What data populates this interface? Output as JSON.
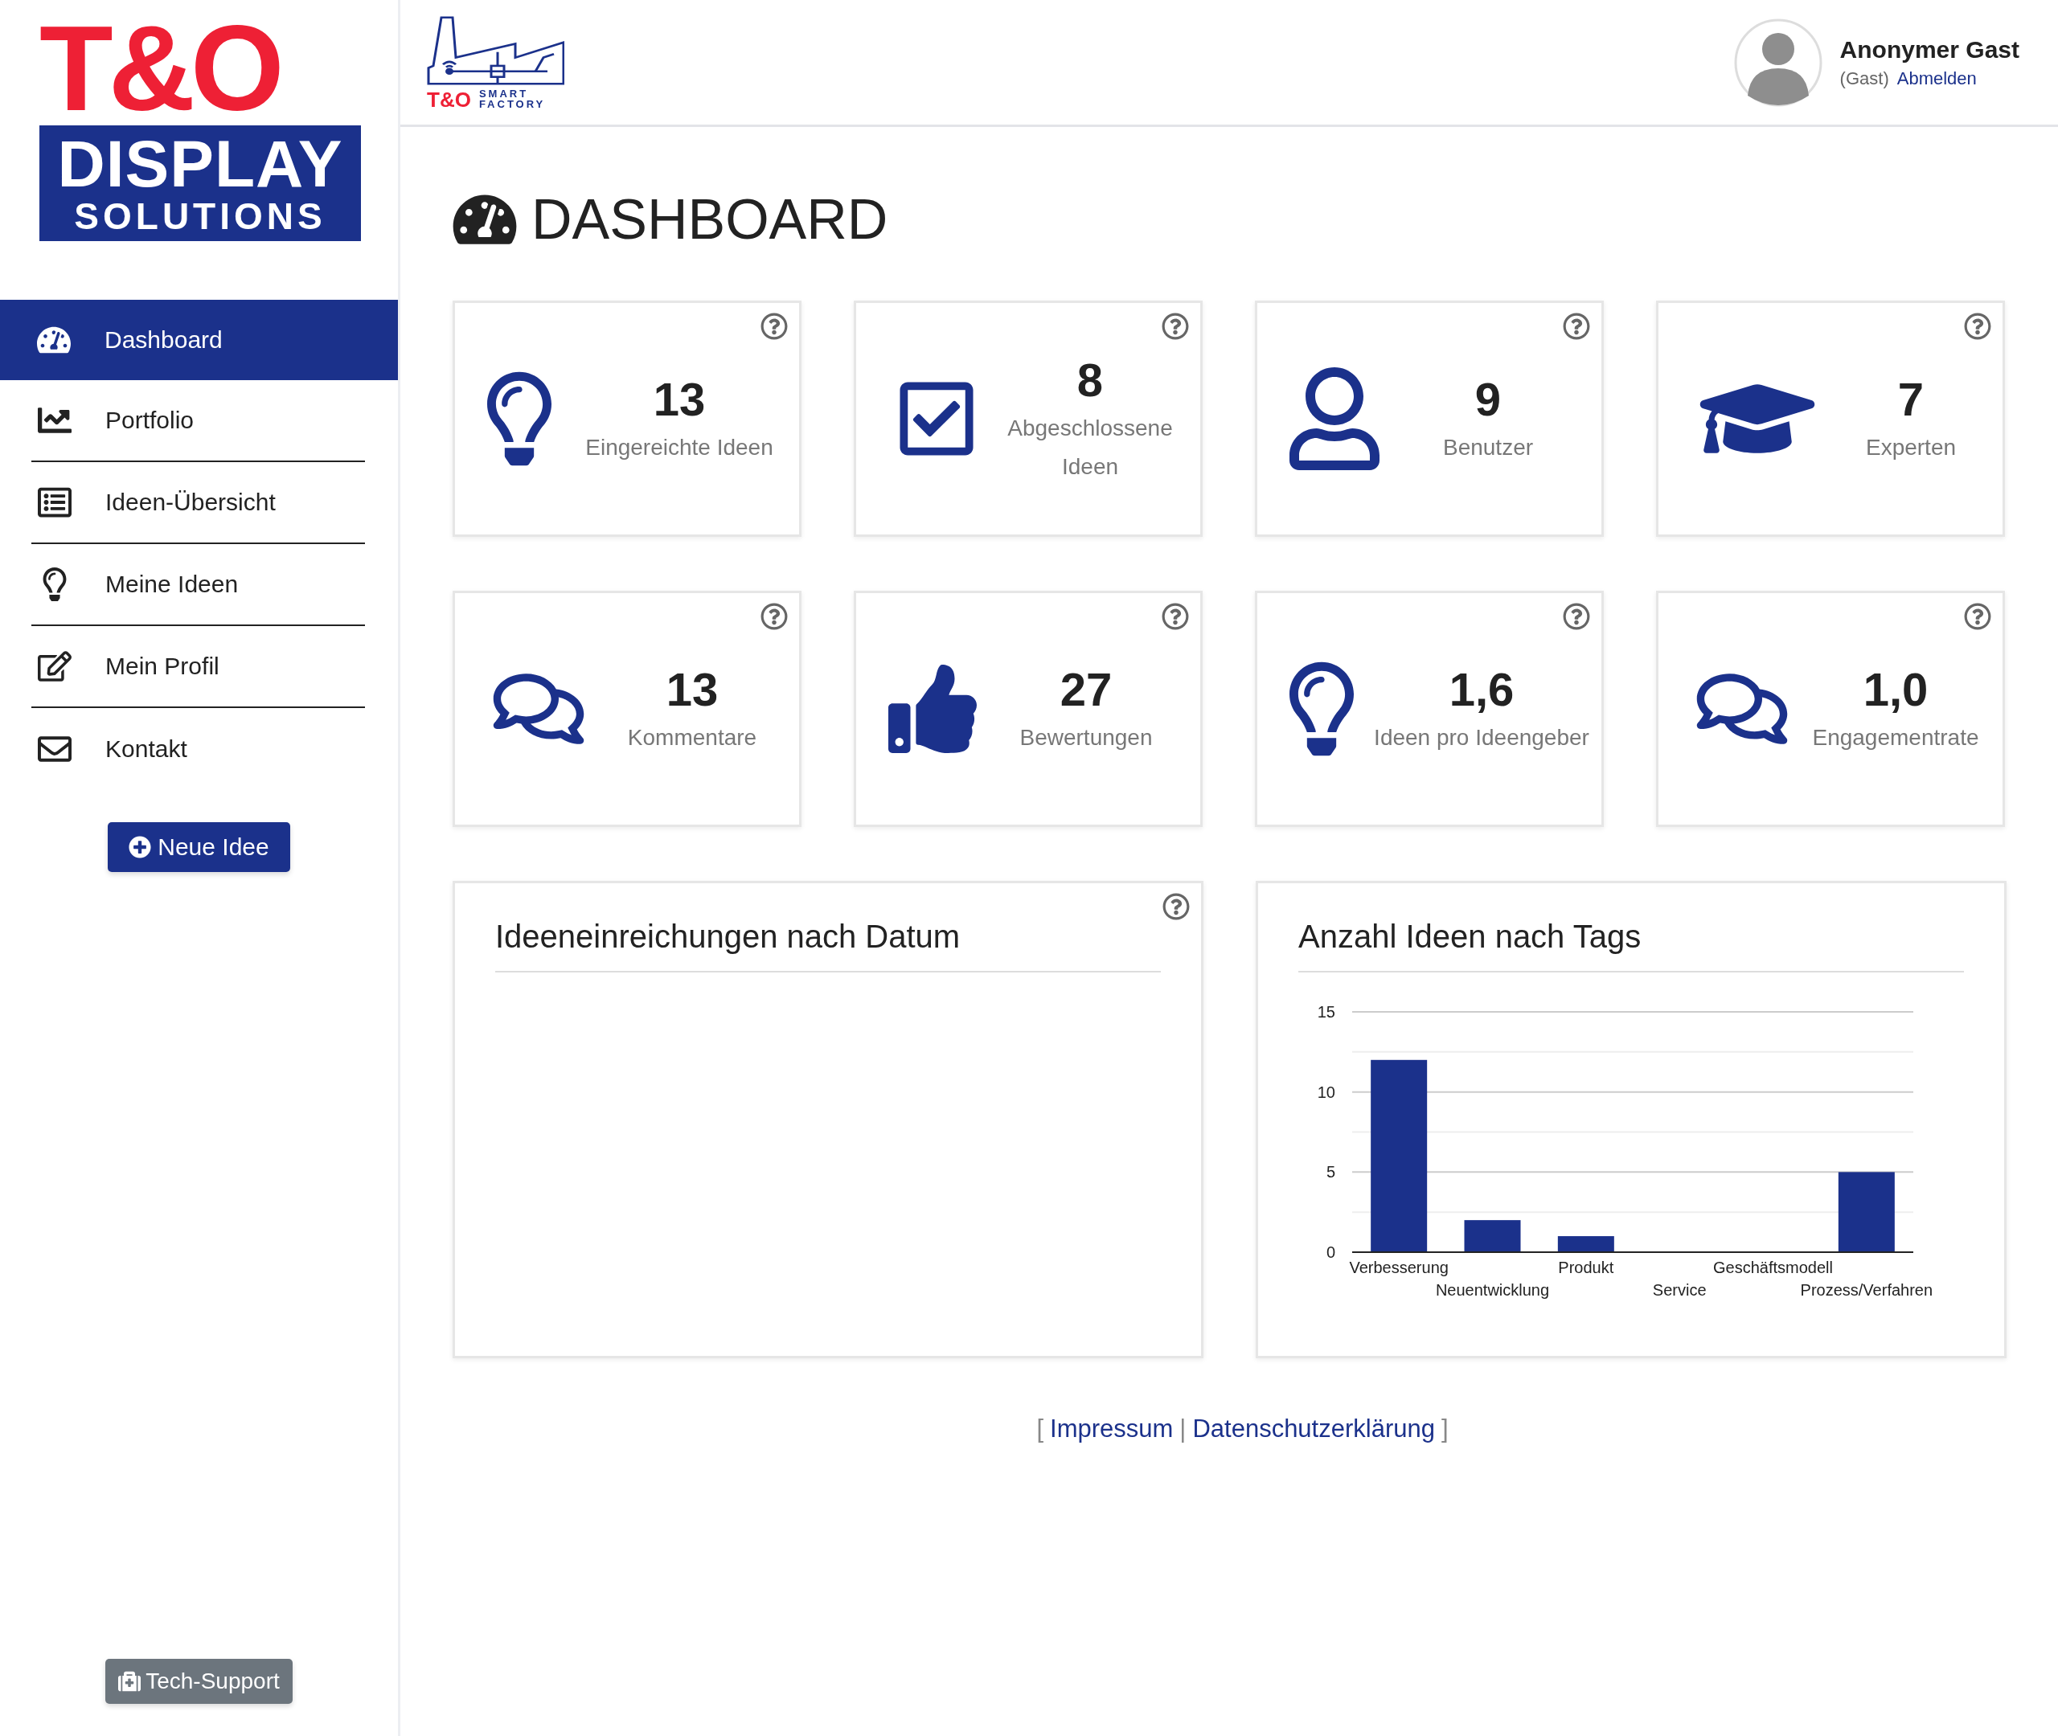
{
  "sidebar": {
    "logo": {
      "brand": "T&O",
      "line1": "DISPLAY",
      "line2": "SOLUTIONS"
    },
    "nav": [
      {
        "label": "Dashboard",
        "kind": "gauge",
        "selected": true
      },
      {
        "label": "Portfolio",
        "kind": "chart",
        "selected": false
      },
      {
        "label": "Ideen-Übersicht",
        "kind": "list",
        "selected": false
      },
      {
        "label": "Meine Ideen",
        "kind": "bulb",
        "selected": false
      },
      {
        "label": "Mein Profil",
        "kind": "edit",
        "selected": false
      },
      {
        "label": "Kontakt",
        "kind": "mail",
        "selected": false
      }
    ],
    "new_button": "Neue Idee",
    "support_button": "Tech-Support"
  },
  "header": {
    "logo": {
      "brand": "T&O",
      "line1": "SMART",
      "line2": "FACTORY"
    },
    "user": {
      "name": "Anonymer Gast",
      "role": "(Gast)",
      "logout": "Abmelden"
    }
  },
  "page_title": "DASHBOARD",
  "stats": [
    {
      "value": "13",
      "label": "Eingereichte Ideen",
      "kind": "bulb",
      "help": true
    },
    {
      "value": "8",
      "label": "Abgeschlossene Ideen",
      "kind": "check",
      "help": true
    },
    {
      "value": "9",
      "label": "Benutzer",
      "kind": "user",
      "help": true
    },
    {
      "value": "7",
      "label": "Experten",
      "kind": "cap",
      "help": true
    },
    {
      "value": "13",
      "label": "Kommentare",
      "kind": "comments",
      "help": true
    },
    {
      "value": "27",
      "label": "Bewertungen",
      "kind": "thumb",
      "help": true
    },
    {
      "value": "1,6",
      "label": "Ideen pro Ideengeber",
      "kind": "bulb",
      "help": true
    },
    {
      "value": "1,0",
      "label": "Engagementrate",
      "kind": "comments",
      "help": true
    }
  ],
  "panels": [
    {
      "title": "Ideeneinreichungen nach Datum",
      "help": true
    },
    {
      "title": "Anzahl Ideen nach Tags",
      "help": false,
      "chart_data": {
        "type": "bar",
        "categories": [
          "Verbesserung",
          "Neuentwicklung",
          "Produkt",
          "Service",
          "Geschäftsmodell",
          "Prozess/Verfahren"
        ],
        "series": [
          {
            "color": "#1b318b",
            "values": [
              12,
              2,
              1,
              0,
              0,
              5
            ]
          }
        ],
        "ylim": [
          0,
          15
        ],
        "yticks": [
          0,
          5,
          10,
          15
        ]
      }
    }
  ],
  "footer": {
    "open": "[",
    "separator": "|",
    "close": "]",
    "links": [
      "Impressum",
      "Datenschutzerklärung"
    ]
  }
}
